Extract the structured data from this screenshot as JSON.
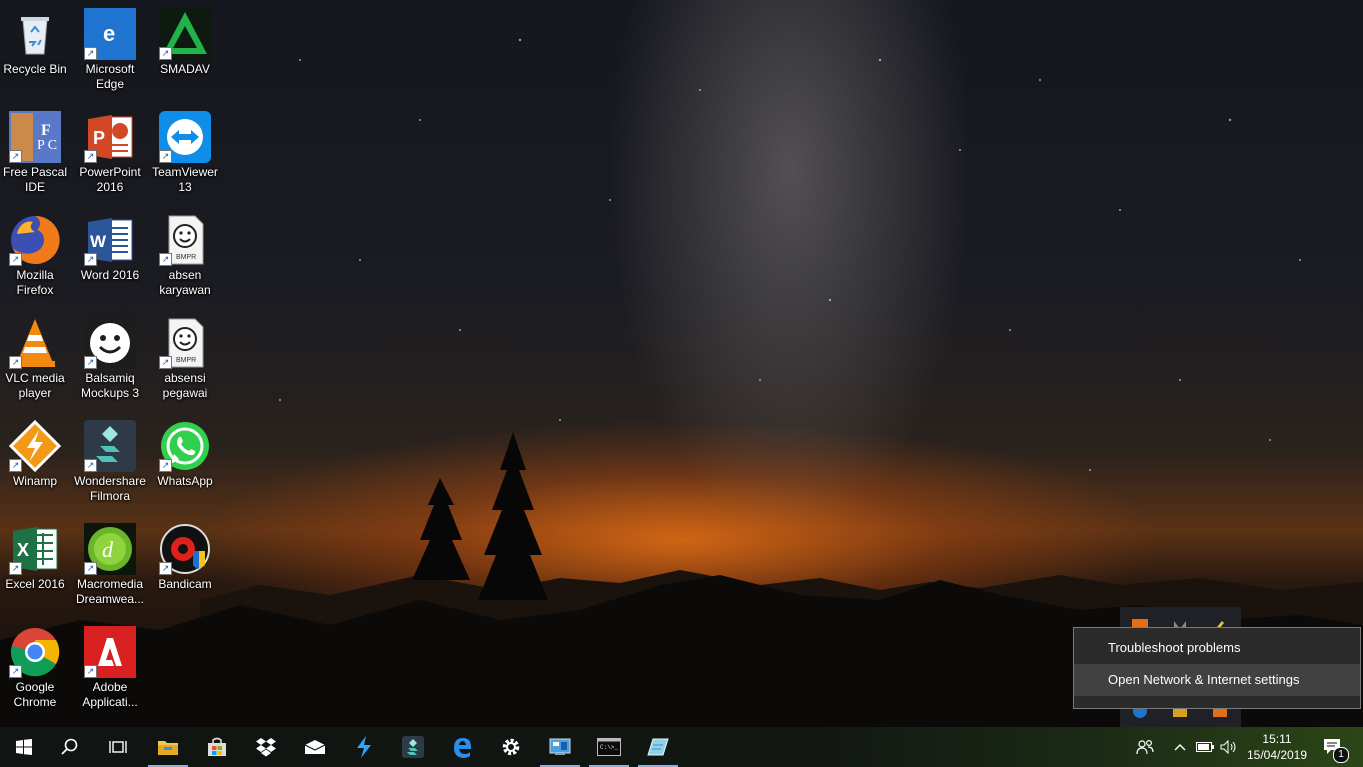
{
  "desktop": {
    "icons": [
      {
        "label": "Recycle Bin",
        "icon": "recycle-bin-icon"
      },
      {
        "label": "Microsoft Edge",
        "icon": "edge-icon"
      },
      {
        "label": "SMADAV",
        "icon": "smadav-icon"
      },
      {
        "label": "Free Pascal IDE",
        "icon": "free-pascal-icon"
      },
      {
        "label": "PowerPoint 2016",
        "icon": "powerpoint-icon"
      },
      {
        "label": "TeamViewer 13",
        "icon": "teamviewer-icon"
      },
      {
        "label": "Mozilla Firefox",
        "icon": "firefox-icon"
      },
      {
        "label": "Word 2016",
        "icon": "word-icon"
      },
      {
        "label": "absen karyawan",
        "icon": "bmpr-file-icon",
        "badge": "BMPR"
      },
      {
        "label": "VLC media player",
        "icon": "vlc-icon"
      },
      {
        "label": "Balsamiq Mockups 3",
        "icon": "balsamiq-icon"
      },
      {
        "label": "absensi pegawai",
        "icon": "bmpr-file-icon",
        "badge": "BMPR"
      },
      {
        "label": "Winamp",
        "icon": "winamp-icon"
      },
      {
        "label": "Wondershare Filmora",
        "icon": "filmora-icon"
      },
      {
        "label": "WhatsApp",
        "icon": "whatsapp-icon"
      },
      {
        "label": "Excel 2016",
        "icon": "excel-icon"
      },
      {
        "label": "Macromedia Dreamwea...",
        "icon": "dreamweaver-icon"
      },
      {
        "label": "Bandicam",
        "icon": "bandicam-icon"
      },
      {
        "label": "Google Chrome",
        "icon": "chrome-icon"
      },
      {
        "label": "Adobe Applicati...",
        "icon": "adobe-icon"
      }
    ]
  },
  "context_menu": {
    "items": [
      "Troubleshoot problems",
      "Open Network & Internet settings"
    ],
    "hovered": "Open Network & Internet settings"
  },
  "taskbar": {
    "buttons": [
      "start-icon",
      "search-icon",
      "task-view-icon",
      "file-explorer-icon",
      "store-icon",
      "dropbox-icon",
      "mail-icon",
      "filmora-launcher-icon",
      "filmora-editor-icon",
      "edge-icon",
      "settings-icon",
      "control-panel-icon",
      "command-prompt-icon",
      "notes-icon"
    ],
    "clock": {
      "time": "15:11",
      "date": "15/04/2019"
    },
    "notification_count": "1",
    "accent_color": "#8fb0d8"
  }
}
